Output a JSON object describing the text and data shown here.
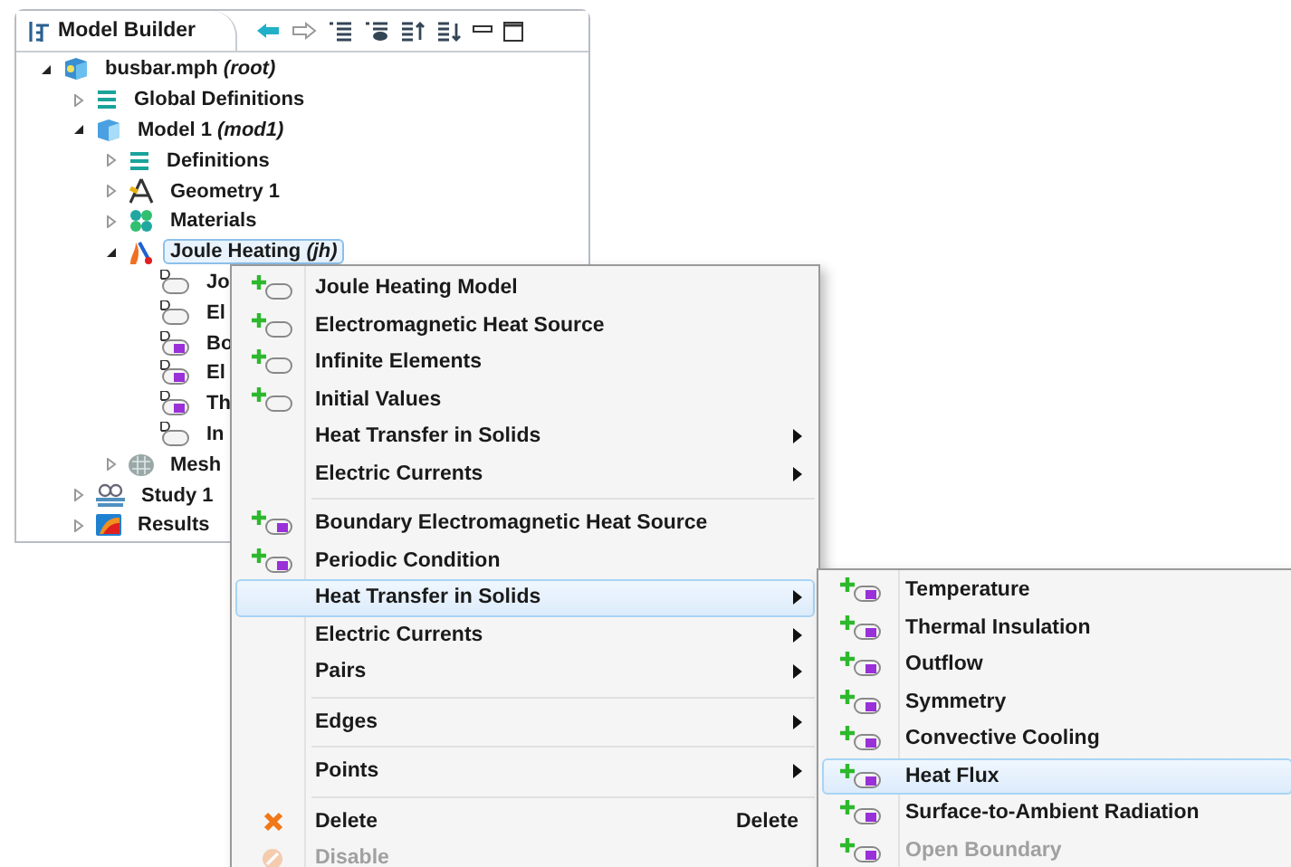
{
  "panel": {
    "title": "Model Builder"
  },
  "tree": [
    {
      "label": "busbar.mph *(root)*",
      "kind": "file",
      "expanded": true,
      "selected": false,
      "children": [
        {
          "label": "Global Definitions",
          "kind": "list",
          "expanded": false,
          "selected": false
        },
        {
          "label": "Model 1 *(mod1)*",
          "kind": "model",
          "expanded": true,
          "selected": false,
          "children": [
            {
              "label": "Definitions",
              "kind": "list",
              "expanded": false,
              "selected": false
            },
            {
              "label": "Geometry 1",
              "kind": "geometry",
              "expanded": false,
              "selected": false
            },
            {
              "label": "Materials",
              "kind": "materials",
              "expanded": false,
              "selected": false
            },
            {
              "label": "Joule Heating *(jh)*",
              "kind": "physics",
              "expanded": true,
              "selected": true,
              "children": [
                {
                  "label": "Jo",
                  "kind": "domain",
                  "selected": false
                },
                {
                  "label": "El",
                  "kind": "domain",
                  "selected": false
                },
                {
                  "label": "Bo",
                  "kind": "boundary",
                  "selected": false
                },
                {
                  "label": "El",
                  "kind": "boundary",
                  "selected": false
                },
                {
                  "label": "Th",
                  "kind": "boundary",
                  "selected": false
                },
                {
                  "label": "In",
                  "kind": "domain",
                  "selected": false
                }
              ]
            },
            {
              "label": "Mesh",
              "kind": "mesh",
              "expanded": false,
              "selected": false
            }
          ]
        },
        {
          "label": "Study 1",
          "kind": "study",
          "expanded": false,
          "selected": false
        },
        {
          "label": "Results",
          "kind": "results",
          "expanded": false,
          "selected": false
        }
      ]
    }
  ],
  "context_menu": {
    "items": [
      {
        "kind": "domain",
        "label": "Joule Heating Model",
        "selected": false,
        "disabled": false
      },
      {
        "kind": "domain",
        "label": "Electromagnetic Heat Source",
        "selected": false,
        "disabled": false
      },
      {
        "kind": "domain",
        "label": "Infinite Elements",
        "selected": false,
        "disabled": false
      },
      {
        "kind": "domain",
        "label": "Initial Values",
        "selected": false,
        "disabled": false
      },
      {
        "kind": "submenu",
        "label": "Heat Transfer in Solids",
        "selected": false,
        "disabled": false
      },
      {
        "kind": "submenu",
        "label": "Electric Currents",
        "selected": false,
        "disabled": false
      },
      {
        "kind": "separator"
      },
      {
        "kind": "boundary",
        "label": "Boundary Electromagnetic Heat Source",
        "selected": false,
        "disabled": false
      },
      {
        "kind": "boundary",
        "label": "Periodic Condition",
        "selected": false,
        "disabled": false
      },
      {
        "kind": "submenu",
        "label": "Heat Transfer in Solids",
        "selected": true,
        "disabled": false
      },
      {
        "kind": "submenu",
        "label": "Electric Currents",
        "selected": false,
        "disabled": false
      },
      {
        "kind": "submenu",
        "label": "Pairs",
        "selected": false,
        "disabled": false
      },
      {
        "kind": "separator"
      },
      {
        "kind": "submenu",
        "label": "Edges",
        "selected": false,
        "disabled": false
      },
      {
        "kind": "separator"
      },
      {
        "kind": "submenu",
        "label": "Points",
        "selected": false,
        "disabled": false
      },
      {
        "kind": "separator"
      },
      {
        "kind": "delete",
        "label": "Delete",
        "shortcut": "Delete",
        "selected": false,
        "disabled": false
      },
      {
        "kind": "disable",
        "label": "Disable",
        "selected": false,
        "disabled": true
      }
    ]
  },
  "submenu": {
    "items": [
      {
        "label": "Temperature",
        "selected": false,
        "disabled": false
      },
      {
        "label": "Thermal Insulation",
        "selected": false,
        "disabled": false
      },
      {
        "label": "Outflow",
        "selected": false,
        "disabled": false
      },
      {
        "label": "Symmetry",
        "selected": false,
        "disabled": false
      },
      {
        "label": "Convective Cooling",
        "selected": false,
        "disabled": false
      },
      {
        "label": "Heat Flux",
        "selected": true,
        "disabled": false
      },
      {
        "label": "Surface-to-Ambient Radiation",
        "selected": false,
        "disabled": false
      },
      {
        "label": "Open Boundary",
        "selected": false,
        "disabled": true
      }
    ]
  }
}
